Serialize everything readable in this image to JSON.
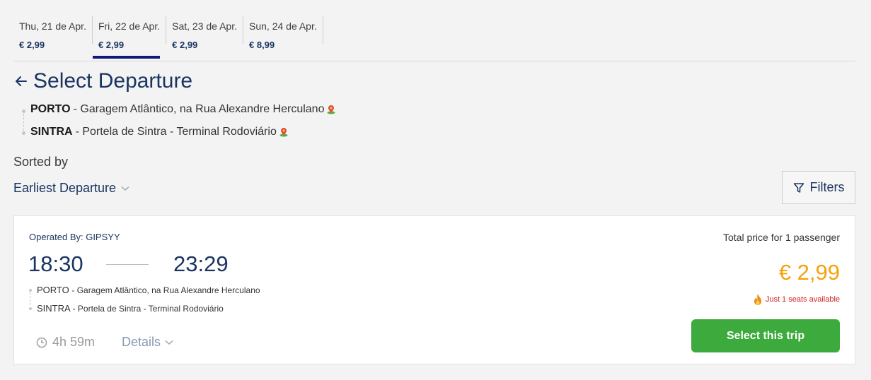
{
  "date_tabs": [
    {
      "date": "Thu, 21 de Apr.",
      "price": "€ 2,99",
      "active": false
    },
    {
      "date": "Fri, 22 de Apr.",
      "price": "€ 2,99",
      "active": true
    },
    {
      "date": "Sat, 23 de Apr.",
      "price": "€ 2,99",
      "active": false
    },
    {
      "date": "Sun, 24 de Apr.",
      "price": "€ 8,99",
      "active": false
    }
  ],
  "header": {
    "title": "Select Departure"
  },
  "route": {
    "origin_city": "PORTO",
    "origin_rest": "- Garagem Atlântico, na Rua Alexandre Herculano",
    "destination_city": "SINTRA",
    "destination_rest": "- Portela de Sintra - Terminal Rodoviário"
  },
  "sort": {
    "label": "Sorted by",
    "value": "Earliest Departure"
  },
  "filters": {
    "label": "Filters"
  },
  "trip": {
    "operated_by": "Operated By: GIPSYY",
    "departure_time": "18:30",
    "arrival_time": "23:29",
    "origin_city": "PORTO",
    "origin_rest": "- Garagem Atlântico, na Rua Alexandre Herculano",
    "destination_city": "SINTRA",
    "destination_rest": "- Portela de Sintra - Terminal Rodoviário",
    "duration": "4h 59m",
    "details_label": "Details",
    "total_label": "Total price for 1 passenger",
    "price": "€ 2,99",
    "seats": "Just 1 seats available",
    "select_label": "Select this trip"
  },
  "colors": {
    "primary": "#1a3561",
    "active_underline": "#0d1a7a",
    "price": "#f4a20a",
    "alert": "#d32020",
    "cta": "#3caa3c"
  }
}
